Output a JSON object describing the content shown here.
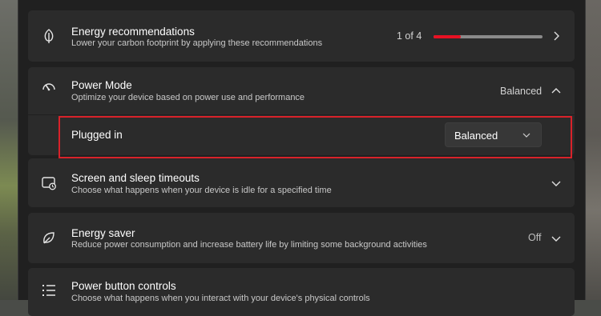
{
  "cards": {
    "energy_recommendations": {
      "title": "Energy recommendations",
      "description": "Lower your carbon footprint by applying these recommendations",
      "progress_text": "1 of 4",
      "progress_fraction": 0.25,
      "icon": "leaf-icon"
    },
    "power_mode": {
      "title": "Power Mode",
      "description": "Optimize your device based on power use and performance",
      "value": "Balanced",
      "icon": "power-mode-gauge-icon",
      "expanded": true,
      "sub": {
        "label": "Plugged in",
        "dropdown_value": "Balanced"
      }
    },
    "screen_sleep": {
      "title": "Screen and sleep timeouts",
      "description": "Choose what happens when your device is idle for a specified time",
      "icon": "screen-sleep-icon"
    },
    "energy_saver": {
      "title": "Energy saver",
      "description": "Reduce power consumption and increase battery life by limiting some background activities",
      "value": "Off",
      "icon": "energy-saver-leaf-icon"
    },
    "power_button": {
      "title": "Power button controls",
      "description": "Choose what happens when you interact with your device's physical controls",
      "icon": "list-icon"
    }
  },
  "colors": {
    "accent": "#e81123",
    "highlight": "#d8222a",
    "card": "#2b2b2b",
    "window": "#202020"
  }
}
